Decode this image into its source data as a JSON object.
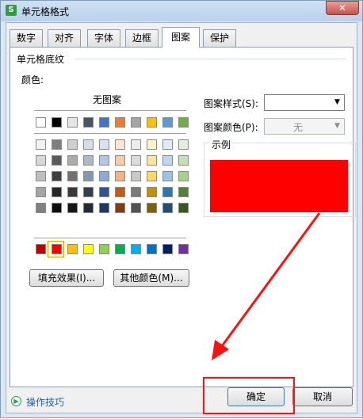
{
  "window": {
    "title": "单元格格式",
    "app_icon_letter": "S",
    "close_glyph": "✕"
  },
  "tabs": [
    {
      "label": "数字",
      "active": false
    },
    {
      "label": "对齐",
      "active": false
    },
    {
      "label": "字体",
      "active": false
    },
    {
      "label": "边框",
      "active": false
    },
    {
      "label": "图案",
      "active": true
    },
    {
      "label": "保护",
      "active": false
    }
  ],
  "shading": {
    "group_label": "单元格底纹",
    "color_label": "颜色:",
    "no_pattern_label": "无图案",
    "selected_color": "#ff0000",
    "top_row": [
      "#ffffff",
      "#000000",
      "#e7e6e6",
      "#44546a",
      "#4472c4",
      "#ed7d31",
      "#a5a5a5",
      "#ffc000",
      "#5b9bd5",
      "#70ad47"
    ],
    "grid": [
      [
        "#f2f2f2",
        "#7f7f7f",
        "#d0cece",
        "#d6dce4",
        "#d9e2f3",
        "#fbe5d5",
        "#ededed",
        "#fff2cc",
        "#deebf6",
        "#e2efd9"
      ],
      [
        "#d8d8d8",
        "#595959",
        "#aeabab",
        "#adb9ca",
        "#b4c6e7",
        "#f7cbac",
        "#dbdbdb",
        "#fee599",
        "#bdd7ee",
        "#c5e0b3"
      ],
      [
        "#bfbfbf",
        "#3f3f3f",
        "#757070",
        "#8496b0",
        "#8eaadb",
        "#f4b183",
        "#c9c9c9",
        "#ffd965",
        "#9cc3e5",
        "#a8d08d"
      ],
      [
        "#a5a5a5",
        "#262626",
        "#3a3838",
        "#323f4f",
        "#2f5496",
        "#c55a11",
        "#7b7b7b",
        "#bf9000",
        "#2e75b5",
        "#538135"
      ],
      [
        "#7f7f7f",
        "#0c0c0c",
        "#171616",
        "#222a35",
        "#1f3864",
        "#833c0b",
        "#525252",
        "#7f6000",
        "#1e4e79",
        "#375623"
      ]
    ],
    "standard_row": [
      "#c00000",
      "#ff0000",
      "#ffc000",
      "#ffff00",
      "#92d050",
      "#00b050",
      "#00b0f0",
      "#0070c0",
      "#002060",
      "#7030a0"
    ],
    "fill_effects_button": "填充效果(I)...",
    "more_colors_button": "其他颜色(M)..."
  },
  "pattern": {
    "style_label": "图案样式(S):",
    "style_value": "",
    "color_label": "图案颜色(P):",
    "color_value": "无"
  },
  "sample": {
    "label": "示例",
    "color": "#ff0000"
  },
  "footer": {
    "tips_label": "操作技巧",
    "ok_label": "确定",
    "cancel_label": "取消"
  },
  "annotation": {
    "color": "#ff1111"
  }
}
